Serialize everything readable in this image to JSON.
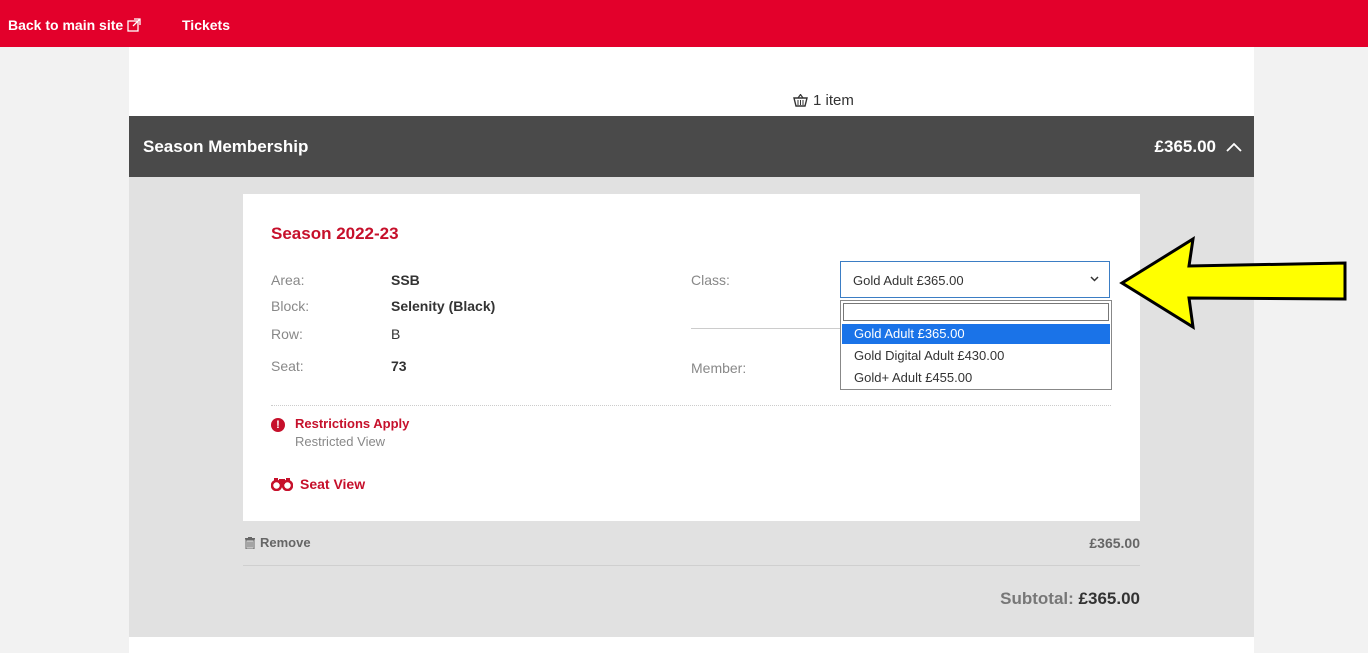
{
  "topbar": {
    "back_label": "Back to main site",
    "tickets_label": "Tickets"
  },
  "basket": {
    "count_text": "1 item"
  },
  "section": {
    "title": "Season Membership",
    "price": "£365.00"
  },
  "card": {
    "season_title": "Season 2022-23",
    "fields": [
      {
        "label": "Area:",
        "value": "SSB"
      },
      {
        "label": "Block:",
        "value": "Selenity (Black)"
      },
      {
        "label": "Row:",
        "value": "B"
      },
      {
        "label": "Seat:",
        "value": "73"
      }
    ],
    "class_label": "Class:",
    "member_label": "Member:",
    "class_select": {
      "selected": "Gold Adult £365.00",
      "options": [
        "Gold Adult £365.00",
        "Gold Digital Adult £430.00",
        "Gold+ Adult £455.00"
      ],
      "highlighted_index": 0
    },
    "restriction_title": "Restrictions Apply",
    "restriction_detail": "Restricted View",
    "seat_view_label": "Seat View"
  },
  "line_item": {
    "remove_label": "Remove",
    "price": "£365.00"
  },
  "subtotal": {
    "label": "Subtotal:",
    "value": "£365.00"
  },
  "colors": {
    "brand_red": "#e3002b",
    "accent_red": "#c6102b",
    "header_grey": "#4a4a4a",
    "select_highlight": "#1a73e8",
    "annotation_yellow": "#ffff00"
  }
}
